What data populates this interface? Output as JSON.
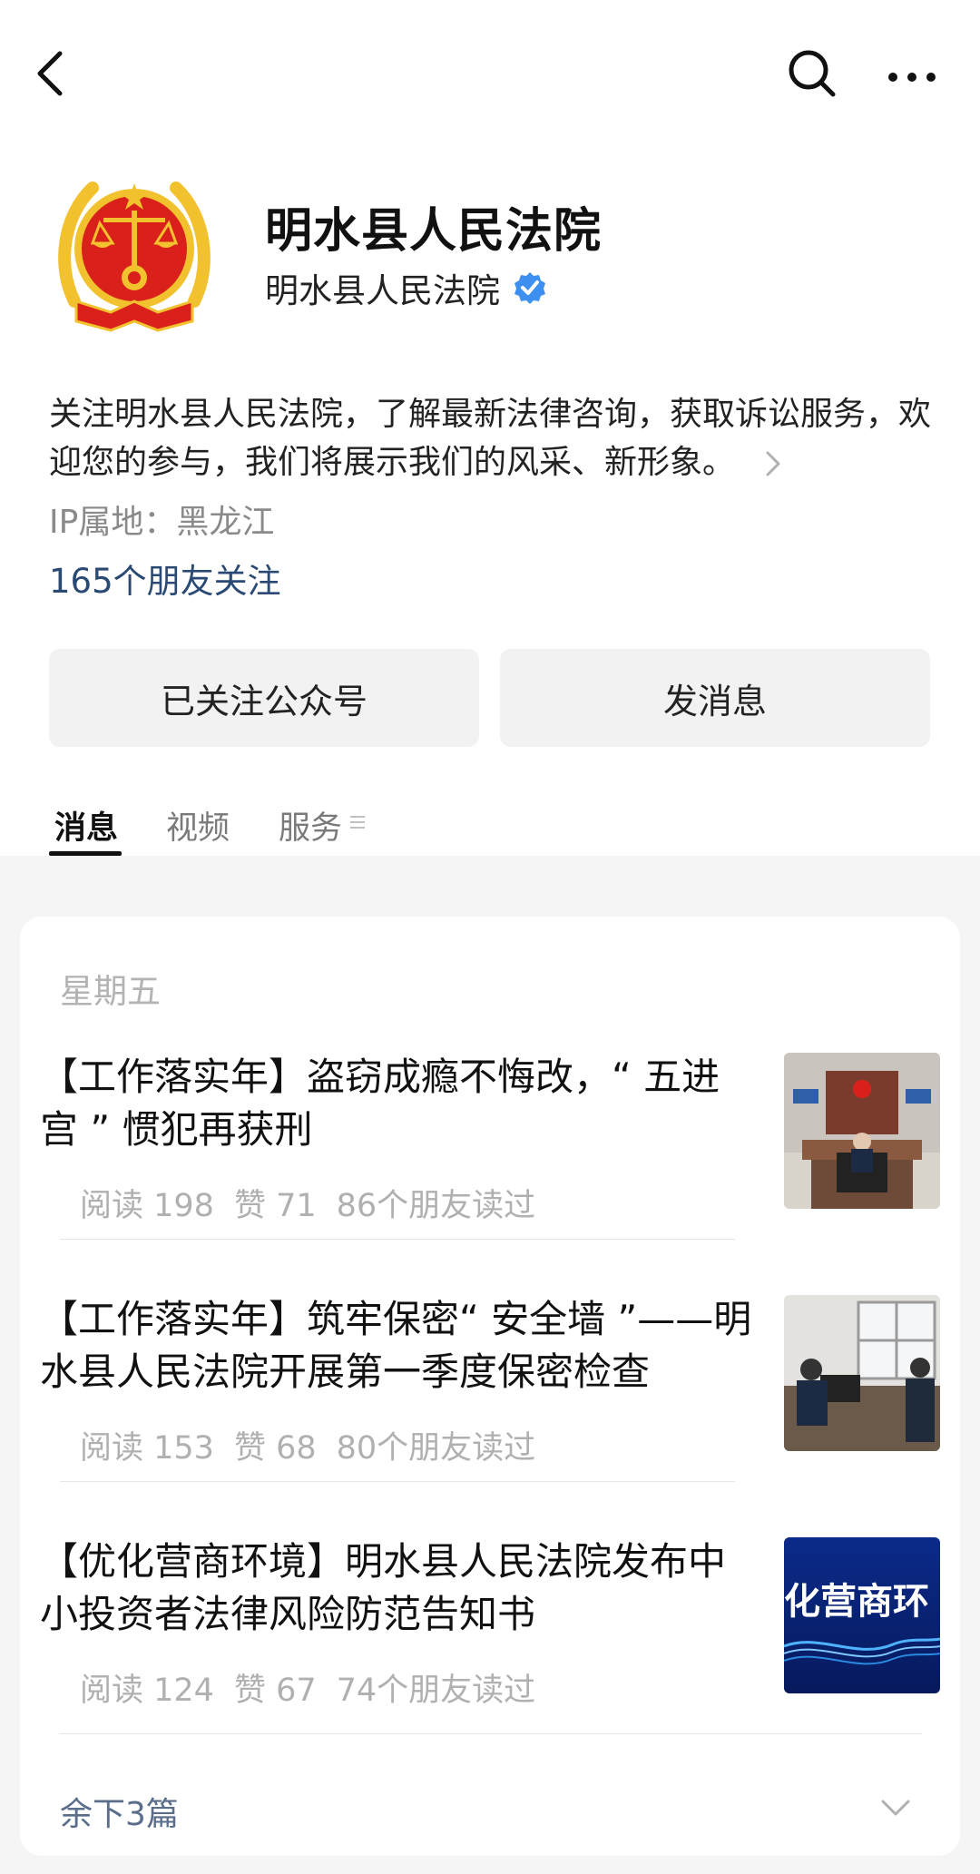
{
  "account": {
    "name": "明水县人民法院",
    "subname": "明水县人民法院",
    "description": "关注明水县人民法院，了解最新法律咨询，获取诉讼服务，欢迎您的参与，我们将展示我们的风采、新形象。",
    "ip_location": "IP属地：黑龙江",
    "friends_following": "165个朋友关注"
  },
  "actions": {
    "follow_label": "已关注公众号",
    "message_label": "发消息"
  },
  "tabs": [
    {
      "label": "消息",
      "active": true
    },
    {
      "label": "视频",
      "active": false
    },
    {
      "label": "服务",
      "active": false
    }
  ],
  "feed": {
    "day": "星期五",
    "articles": [
      {
        "title": "【工作落实年】盗窃成瘾不悔改，“ 五进宫 ” 惯犯再获刑",
        "reads": "阅读 198",
        "likes": "赞 71",
        "friends_read": "86个朋友读过",
        "thumb_icon": "courtroom-photo"
      },
      {
        "title": "【工作落实年】筑牢保密“ 安全墙 ”——明水县人民法院开展第一季度保密检查",
        "reads": "阅读 153",
        "likes": "赞 68",
        "friends_read": "80个朋友读过",
        "thumb_icon": "office-inspection-photo"
      },
      {
        "title": "【优化营商环境】明水县人民法院发布中小投资者法律风险防范告知书",
        "reads": "阅读 124",
        "likes": "赞 67",
        "friends_read": "74个朋友读过",
        "thumb_icon": "business-banner-image",
        "thumb_text": "化营商环"
      }
    ],
    "remaining": "余下3篇"
  },
  "colors": {
    "accent_blue": "#2a4a74",
    "verified_blue": "#3d8ff0",
    "emblem_red": "#d9201b",
    "emblem_gold": "#f2c12e"
  }
}
